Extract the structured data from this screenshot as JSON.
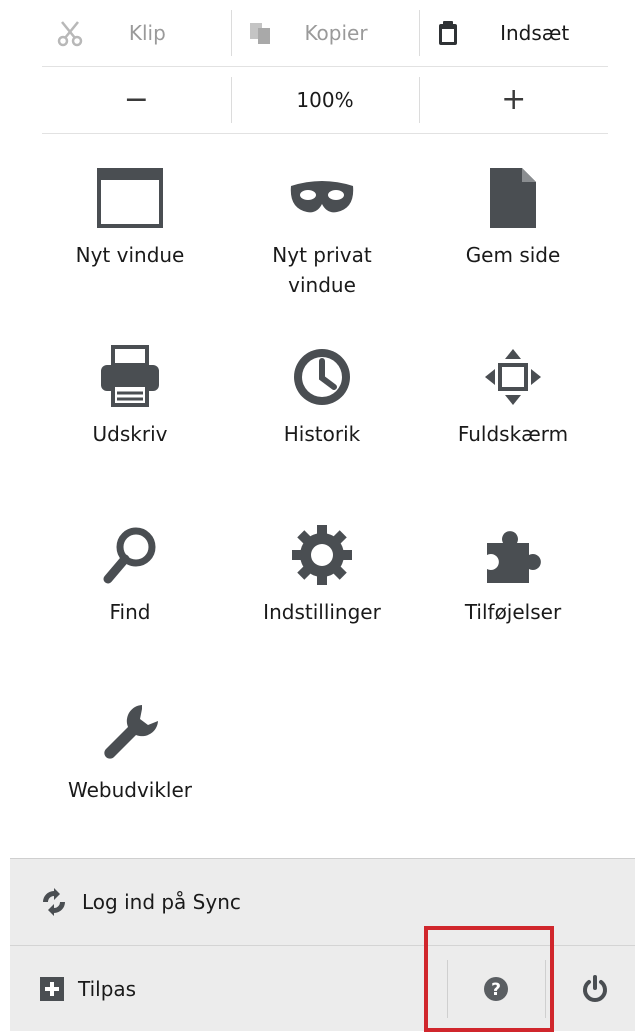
{
  "edit": {
    "cut_label": "Klip",
    "copy_label": "Kopier",
    "paste_label": "Indsæt"
  },
  "zoom": {
    "minus": "−",
    "value": "100%",
    "plus": "+"
  },
  "grid": {
    "new_window": "Nyt vindue",
    "new_private_line1": "Nyt privat",
    "new_private_line2": "vindue",
    "save_page": "Gem side",
    "print": "Udskriv",
    "history": "Historik",
    "fullscreen": "Fuldskærm",
    "find": "Find",
    "options": "Indstillinger",
    "addons": "Tilføjelser",
    "developer": "Webudvikler"
  },
  "footer": {
    "sync_label": "Log ind på Sync",
    "customize_label": "Tilpas"
  },
  "colors": {
    "icon_gray": "#4a4e52",
    "highlight": "#d0262c",
    "footer_bg": "#ececec"
  }
}
